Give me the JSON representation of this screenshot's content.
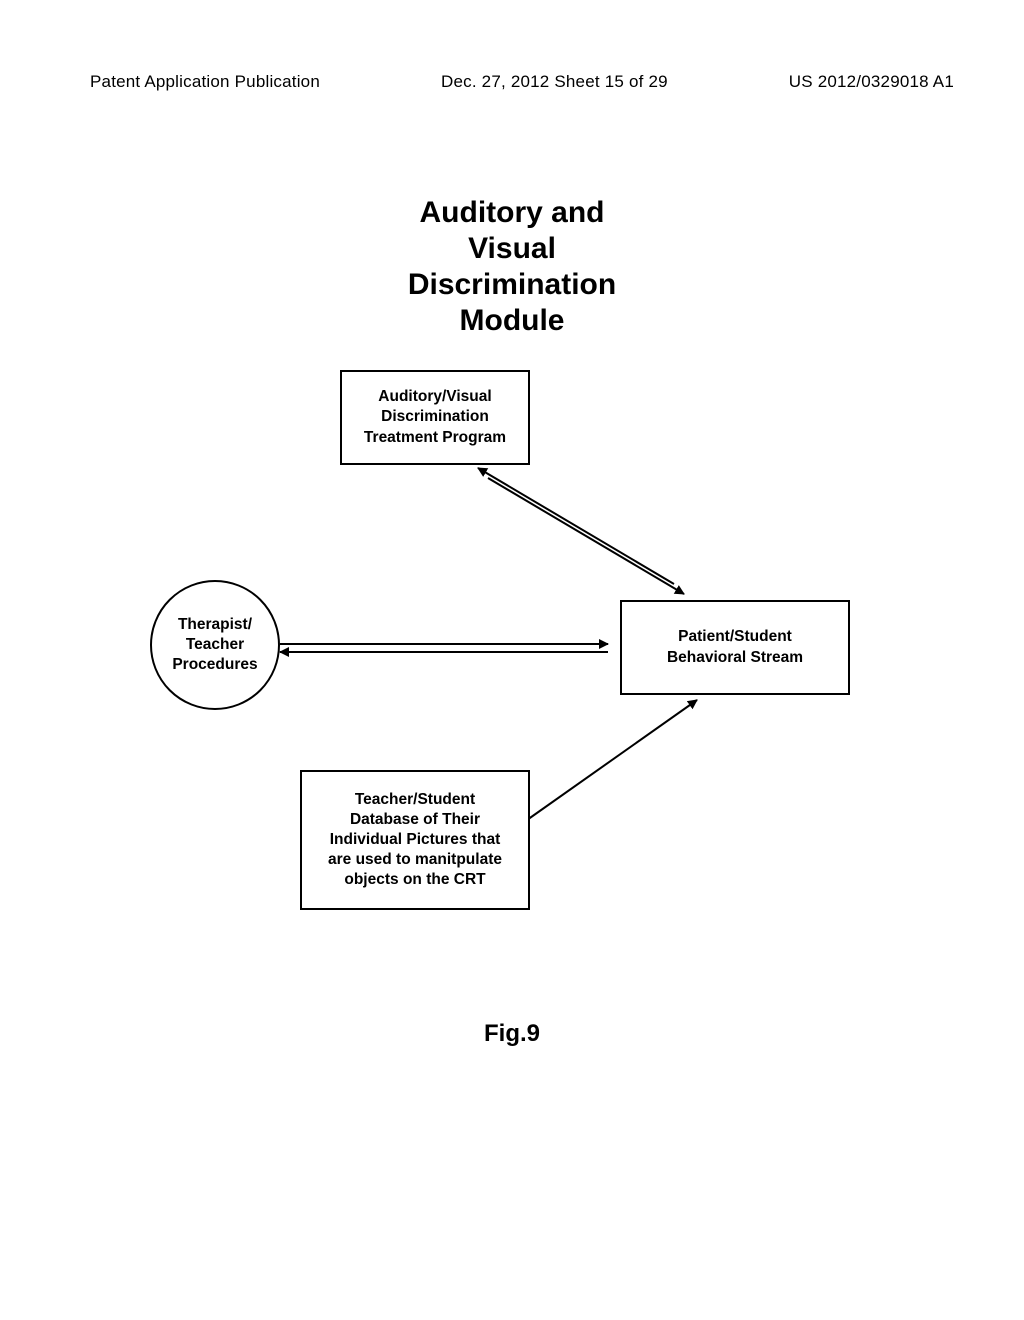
{
  "header": {
    "left": "Patent Application Publication",
    "mid": "Dec. 27, 2012  Sheet 15 of 29",
    "right": "US 2012/0329018 A1"
  },
  "title": {
    "l1": "Auditory and",
    "l2": "Visual",
    "l3": "Discrimination",
    "l4": "Module"
  },
  "nodes": {
    "treatment": "Auditory/Visual\nDiscrimination\nTreatment Program",
    "therapist": "Therapist/\nTeacher\nProcedures",
    "patient": "Patient/Student\nBehavioral Stream",
    "database": "Teacher/Student\nDatabase of Their\nIndividual Pictures that\nare used to manitpulate\nobjects on the CRT"
  },
  "figure_label": "Fig.9",
  "chart_data": {
    "type": "diagram",
    "title": "Auditory and Visual Discrimination Module",
    "nodes": [
      {
        "id": "treatment",
        "shape": "rectangle",
        "label": "Auditory/Visual Discrimination Treatment Program"
      },
      {
        "id": "therapist",
        "shape": "circle",
        "label": "Therapist/Teacher Procedures"
      },
      {
        "id": "patient",
        "shape": "rectangle",
        "label": "Patient/Student Behavioral Stream"
      },
      {
        "id": "database",
        "shape": "rectangle",
        "label": "Teacher/Student Database of Their Individual Pictures that are used to manitpulate objects on the CRT"
      }
    ],
    "edges": [
      {
        "from": "treatment",
        "to": "patient",
        "bidirectional": true
      },
      {
        "from": "therapist",
        "to": "patient",
        "bidirectional": true
      },
      {
        "from": "database",
        "to": "patient",
        "bidirectional": false
      }
    ],
    "figure_label": "Fig.9"
  }
}
